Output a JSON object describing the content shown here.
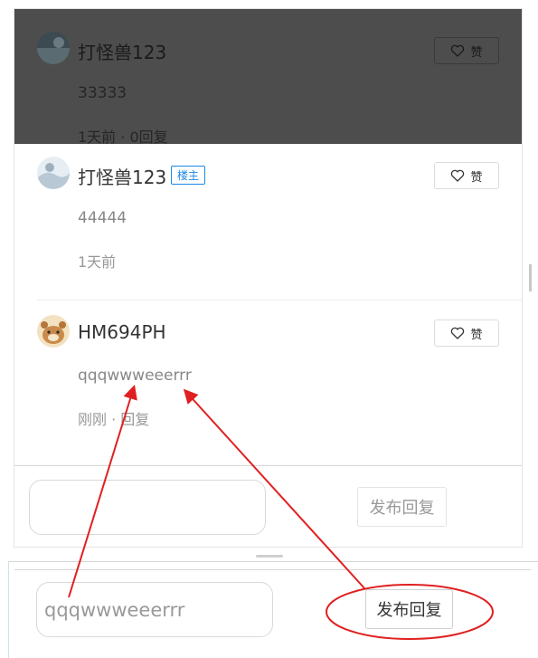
{
  "comments": [
    {
      "user": "打怪兽123",
      "content": "33333",
      "meta": "1天前 · 0回复",
      "like_label": "赞"
    },
    {
      "user": "打怪兽123",
      "tag": "楼主",
      "content": "44444",
      "meta": "1天前",
      "like_label": "赞"
    },
    {
      "user": "HM694PH",
      "content": "qqqwwweeerrr",
      "meta": "刚刚 · 回复",
      "like_label": "赞"
    }
  ],
  "composer": {
    "input_value": "",
    "submit_label": "发布回复"
  },
  "composer_lower": {
    "input_value": "qqqwwweeerrr",
    "submit_label": "发布回复"
  },
  "colors": {
    "accent": "#1e88e5",
    "annotation": "#e02020",
    "overlay": "#4d4d4d"
  }
}
